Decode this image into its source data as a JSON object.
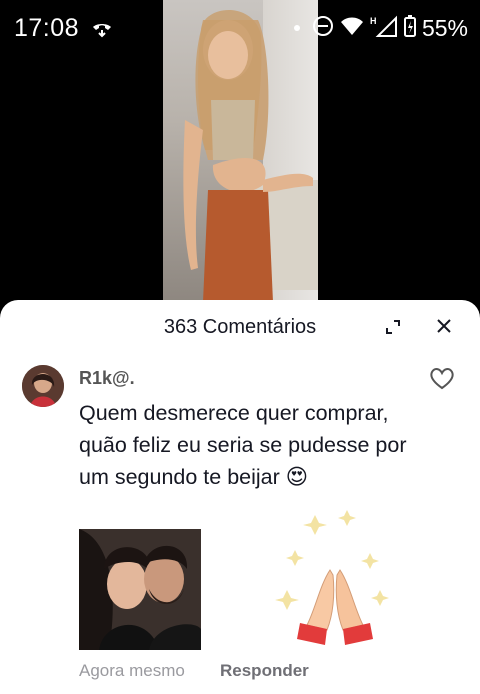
{
  "status_bar": {
    "time": "17:08",
    "battery": "55%"
  },
  "comments_panel": {
    "title": "363 Comentários",
    "comment": {
      "username": "R1k@.",
      "text": "Quem desmerece quer comprar, quão feliz eu seria se pudesse por um segundo te beijar 😍",
      "timestamp": "Agora mesmo",
      "reply_label": "Responder"
    }
  },
  "colors": {
    "panel_bg": "#ffffff",
    "text": "#161823",
    "muted": "#9a9a9f"
  },
  "icons": [
    "phone-call-icon",
    "dnd-icon",
    "wifi-icon",
    "signal-icon",
    "battery-icon",
    "expand-icon",
    "close-icon",
    "heart-icon",
    "pray-icon"
  ]
}
